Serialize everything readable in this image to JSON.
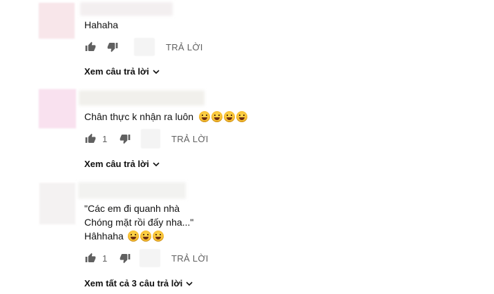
{
  "comments": [
    {
      "lines": [
        "Hahaha"
      ],
      "emoji_count": 0,
      "like_count": "",
      "reply_label": "TRẢ LỜI",
      "view_replies_label": "Xem câu trả lời"
    },
    {
      "lines": [
        "Chân thực k nhận ra luôn"
      ],
      "emoji_count": 4,
      "emoji_name": "laughing-squint-emoji",
      "like_count": "1",
      "reply_label": "TRẢ LỜI",
      "view_replies_label": "Xem câu trả lời"
    },
    {
      "lines": [
        "\"Các em đi quanh nhà",
        "Chóng mặt rồi đấy nha...\"",
        "Hâhhaha"
      ],
      "emoji_count": 3,
      "emoji_name": "tears-of-joy-emoji",
      "like_count": "1",
      "reply_label": "TRẢ LỜI",
      "view_replies_label": "Xem tất cả 3 câu trả lời"
    }
  ],
  "icons": {
    "like": "thumbs-up-icon",
    "dislike": "thumbs-down-icon",
    "expand": "chevron-down-icon"
  },
  "colors": {
    "muted": "#606060",
    "text": "#0f0f0f"
  }
}
